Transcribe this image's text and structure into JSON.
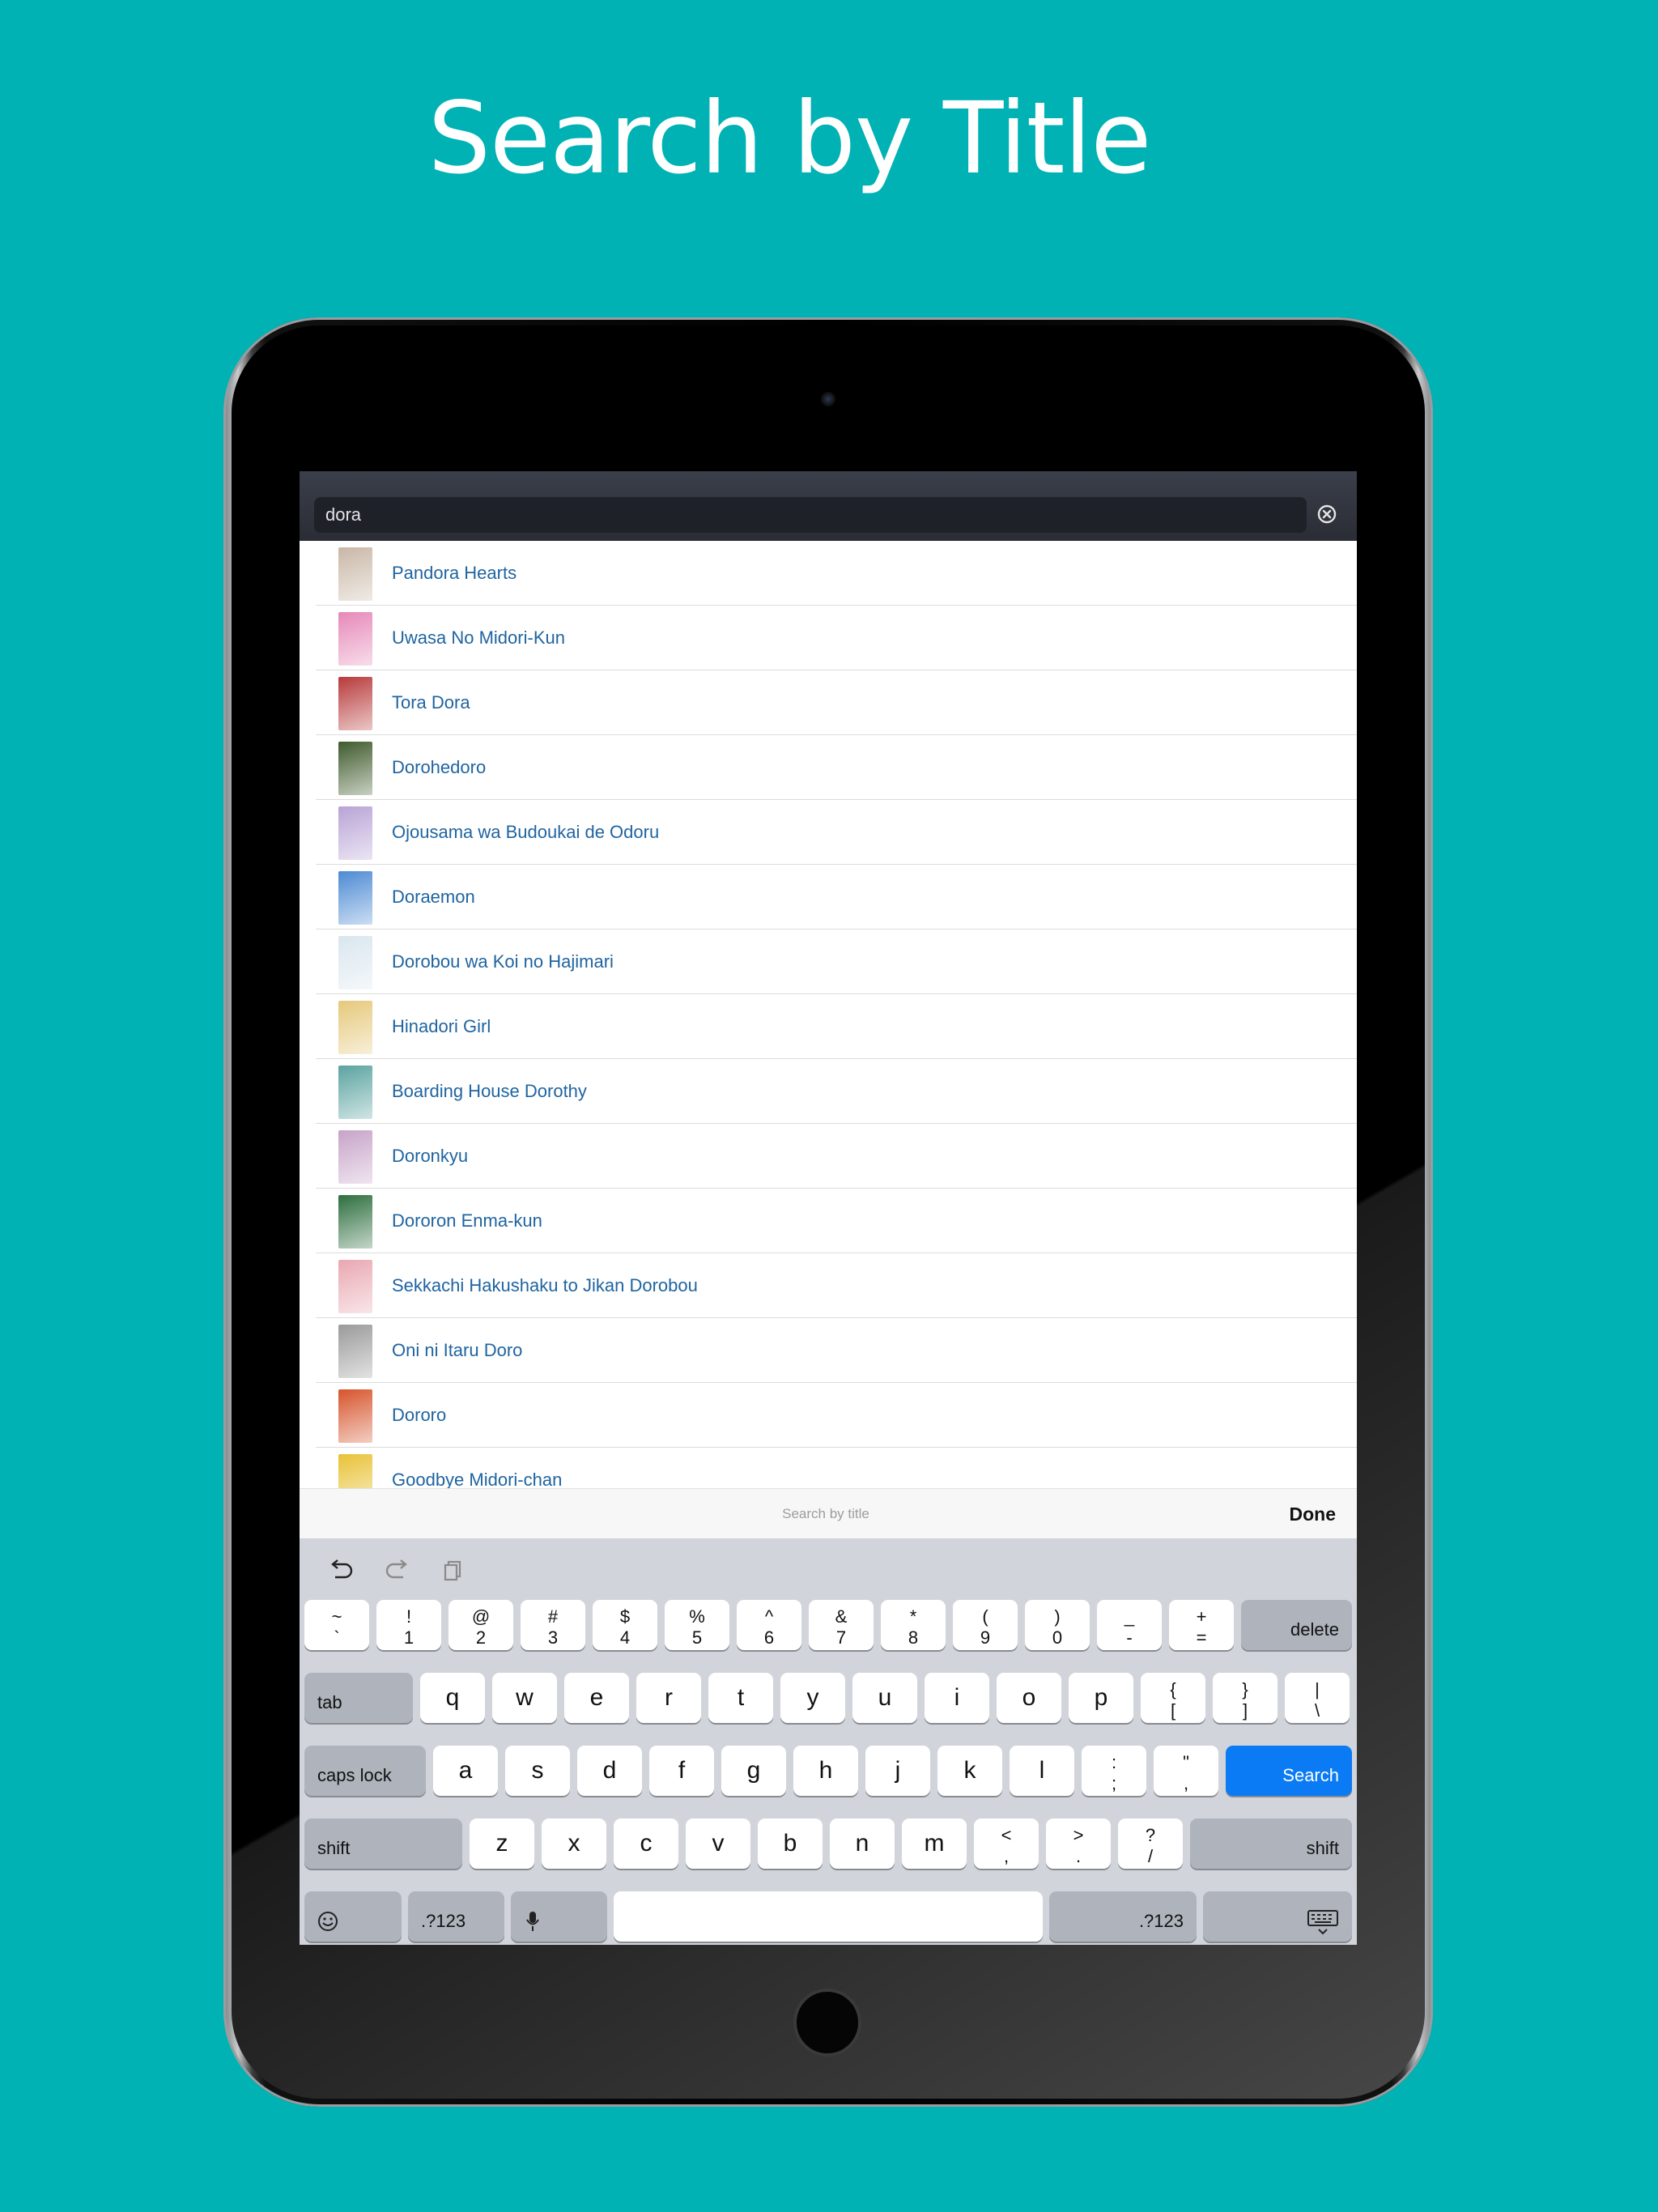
{
  "headline": "Search by Title",
  "search": {
    "query": "dora"
  },
  "results": [
    {
      "title": "Pandora Hearts",
      "thumb": "#c9b7a6"
    },
    {
      "title": "Uwasa No Midori-Kun",
      "thumb": "#e688b8"
    },
    {
      "title": "Tora Dora",
      "thumb": "#b83a3a"
    },
    {
      "title": "Dorohedoro",
      "thumb": "#3f5a2c"
    },
    {
      "title": "Ojousama wa Budoukai de Odoru",
      "thumb": "#b8a3d6"
    },
    {
      "title": "Doraemon",
      "thumb": "#4d8ad4"
    },
    {
      "title": "Dorobou wa Koi no Hajimari",
      "thumb": "#d9e6ee"
    },
    {
      "title": "Hinadori Girl",
      "thumb": "#e5c87a"
    },
    {
      "title": "Boarding House Dorothy",
      "thumb": "#5aa3a0"
    },
    {
      "title": "Doronkyu",
      "thumb": "#c7a3c8"
    },
    {
      "title": "Dororon Enma-kun",
      "thumb": "#2d6e3e"
    },
    {
      "title": "Sekkachi Hakushaku to Jikan Dorobou",
      "thumb": "#e9a7b1"
    },
    {
      "title": "Oni ni Itaru Doro",
      "thumb": "#9a9a9a"
    },
    {
      "title": "Dororo",
      "thumb": "#d6542c"
    },
    {
      "title": "Goodbye Midori-chan",
      "thumb": "#e8c236"
    }
  ],
  "accessory": {
    "hint": "Search by title",
    "done": "Done"
  },
  "keyboard": {
    "row1": [
      {
        "top": "~",
        "bottom": "`"
      },
      {
        "top": "!",
        "bottom": "1"
      },
      {
        "top": "@",
        "bottom": "2"
      },
      {
        "top": "#",
        "bottom": "3"
      },
      {
        "top": "$",
        "bottom": "4"
      },
      {
        "top": "%",
        "bottom": "5"
      },
      {
        "top": "^",
        "bottom": "6"
      },
      {
        "top": "&",
        "bottom": "7"
      },
      {
        "top": "*",
        "bottom": "8"
      },
      {
        "top": "(",
        "bottom": "9"
      },
      {
        "top": ")",
        "bottom": "0"
      },
      {
        "top": "_",
        "bottom": "-"
      },
      {
        "top": "+",
        "bottom": "="
      }
    ],
    "delete": "delete",
    "tab": "tab",
    "row2": [
      "q",
      "w",
      "e",
      "r",
      "t",
      "y",
      "u",
      "i",
      "o",
      "p"
    ],
    "row2_sym": [
      {
        "top": "{",
        "bottom": "["
      },
      {
        "top": "}",
        "bottom": "]"
      },
      {
        "top": "|",
        "bottom": "\\"
      }
    ],
    "caps": "caps lock",
    "row3": [
      "a",
      "s",
      "d",
      "f",
      "g",
      "h",
      "j",
      "k",
      "l"
    ],
    "row3_sym": [
      {
        "top": ":",
        "bottom": ";"
      },
      {
        "top": "\"",
        "bottom": ","
      }
    ],
    "search": "Search",
    "shift": "shift",
    "row4": [
      "z",
      "x",
      "c",
      "v",
      "b",
      "n",
      "m"
    ],
    "row4_sym": [
      {
        "top": "<",
        "bottom": ","
      },
      {
        "top": ">",
        "bottom": "."
      },
      {
        "top": "?",
        "bottom": "/"
      }
    ],
    "numbers": ".?123"
  },
  "colors": {
    "background": "#00b2b4",
    "link": "#1f64a0",
    "search_key": "#0a7bf5"
  }
}
